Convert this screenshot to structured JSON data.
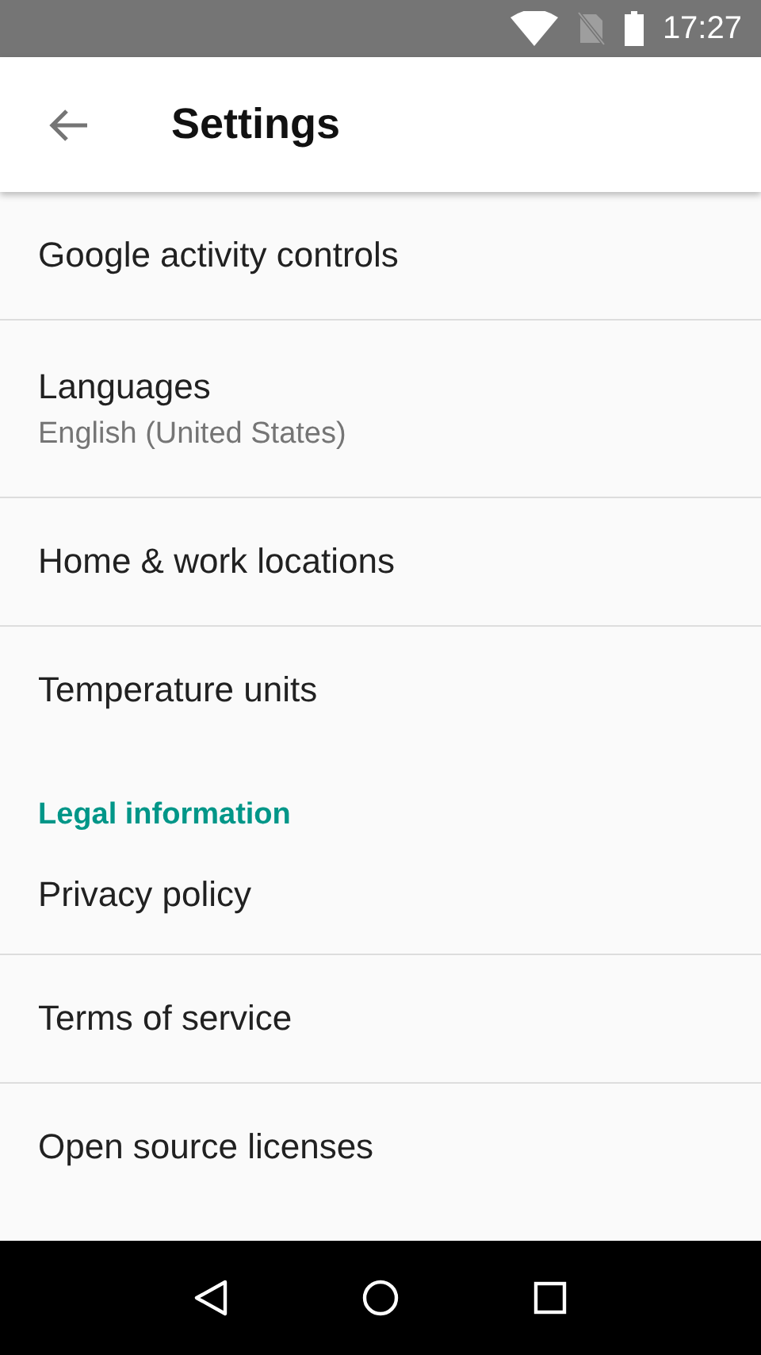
{
  "status_bar": {
    "time": "17:27"
  },
  "app_bar": {
    "title": "Settings"
  },
  "sections": [
    {
      "items": [
        {
          "title": "Google activity controls"
        },
        {
          "title": "Languages",
          "summary": "English (United States)"
        },
        {
          "title": "Home & work locations"
        },
        {
          "title": "Temperature units"
        }
      ]
    },
    {
      "header": "Legal information",
      "items": [
        {
          "title": "Privacy policy"
        },
        {
          "title": "Terms of service"
        },
        {
          "title": "Open source licenses"
        }
      ]
    }
  ]
}
